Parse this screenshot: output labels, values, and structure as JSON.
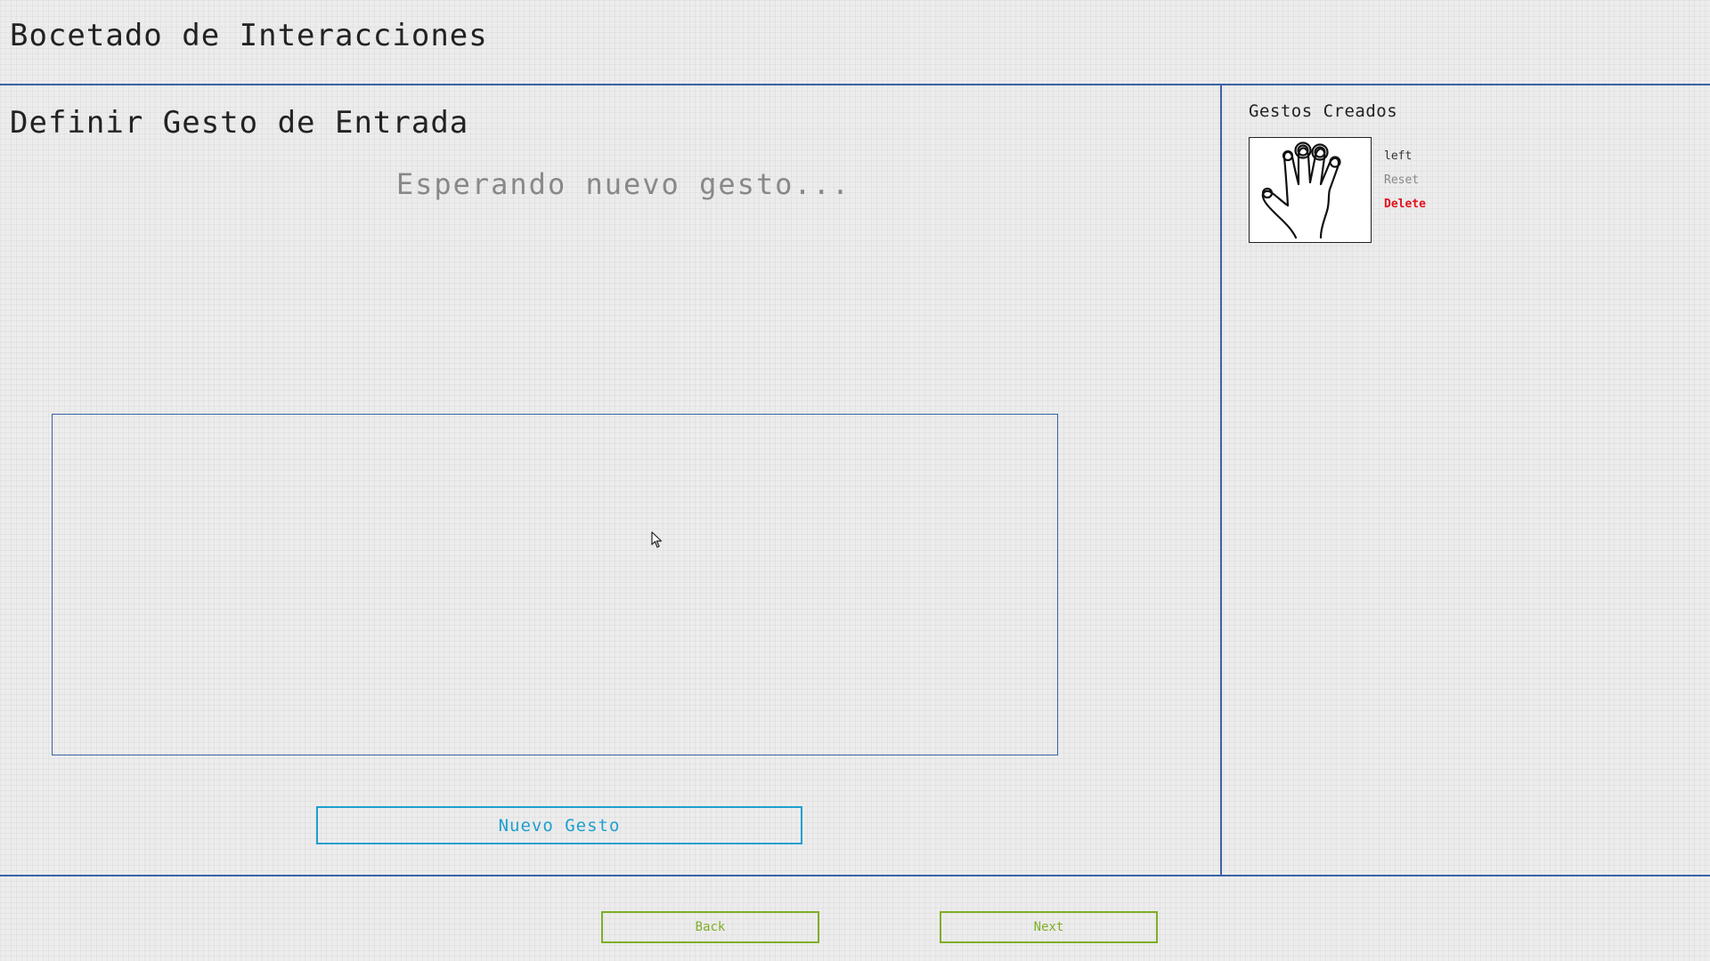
{
  "app": {
    "title": "Bocetado de Interacciones"
  },
  "main": {
    "section_title": "Definir Gesto de Entrada",
    "status": "Esperando nuevo gesto...",
    "new_gesture_label": "Nuevo Gesto"
  },
  "sidebar": {
    "title": "Gestos Creados",
    "gestures": [
      {
        "icon": "hand-gesture-icon",
        "name": "left",
        "reset_label": "Reset",
        "delete_label": "Delete"
      }
    ]
  },
  "footer": {
    "back_label": "Back",
    "next_label": "Next"
  },
  "colors": {
    "divider": "#3a63a5",
    "primary_button": "#1e9fce",
    "nav_button": "#7fae26",
    "delete": "#e0141e",
    "status_text": "#888888"
  }
}
